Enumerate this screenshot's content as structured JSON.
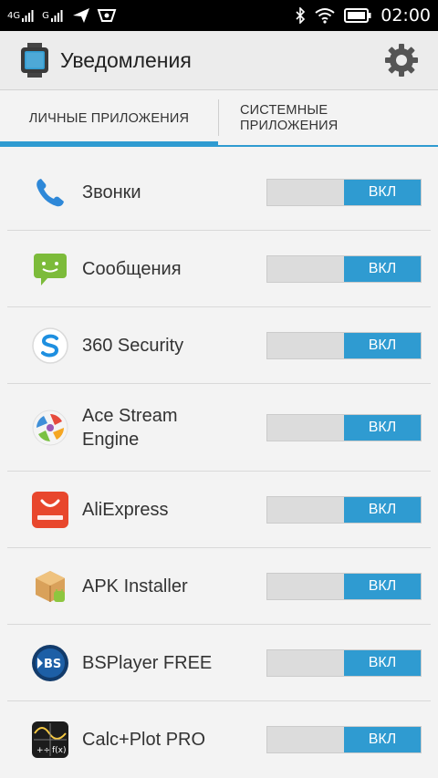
{
  "statusbar": {
    "net1": "4G",
    "net2": "G",
    "time": "02:00"
  },
  "actionbar": {
    "title": "Уведомления"
  },
  "tabs": [
    {
      "label": "ЛИЧНЫЕ ПРИЛОЖЕНИЯ",
      "selected": true
    },
    {
      "label": "СИСТЕМНЫЕ ПРИЛОЖЕНИЯ",
      "selected": false
    }
  ],
  "apps": [
    {
      "name": "Звонки",
      "toggle": "ВКЛ",
      "icon": "phone-icon"
    },
    {
      "name": "Сообщения",
      "toggle": "ВКЛ",
      "icon": "messages-icon"
    },
    {
      "name": "360 Security",
      "toggle": "ВКЛ",
      "icon": "360-security-icon"
    },
    {
      "name": "Ace Stream Engine",
      "toggle": "ВКЛ",
      "icon": "ace-stream-icon"
    },
    {
      "name": "AliExpress",
      "toggle": "ВКЛ",
      "icon": "aliexpress-icon"
    },
    {
      "name": "APK Installer",
      "toggle": "ВКЛ",
      "icon": "apk-installer-icon"
    },
    {
      "name": "BSPlayer FREE",
      "toggle": "ВКЛ",
      "icon": "bsplayer-icon"
    },
    {
      "name": "Calc+Plot PRO",
      "toggle": "ВКЛ",
      "icon": "calc-plot-icon"
    }
  ],
  "colors": {
    "accent": "#2f9bd1",
    "toggle_off": "#dcdcdc"
  }
}
